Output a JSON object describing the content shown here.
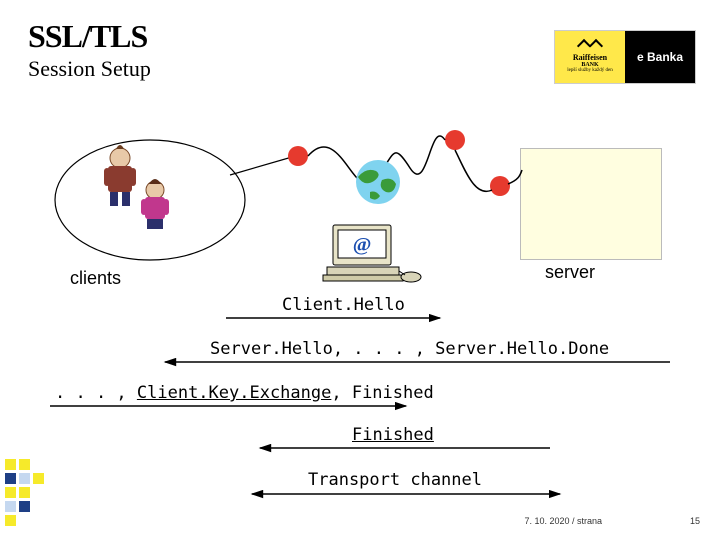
{
  "title": "SSL/TLS",
  "subtitle": "Session Setup",
  "logo": {
    "bank": "Raiffeisen",
    "sub": "BANK",
    "tag": "lepší služby každý den",
    "ebank": "e Banka"
  },
  "labels": {
    "clients": "clients",
    "server": "server"
  },
  "messages": {
    "m1": "Client.Hello",
    "m2": "Server.Hello, . . . , Server.Hello.Done",
    "m3_a": ". . . , ",
    "m3_b": "Client.Key.Exchange",
    "m3_c": ", Finished",
    "m4": "Finished",
    "m5": "Transport channel"
  },
  "footer": {
    "date": "7. 10. 2020 / strana",
    "page": "15"
  },
  "accent": {
    "yellow": "#f6ea2a",
    "darkblue": "#1e3f85",
    "lightblue": "#c5d8f0"
  }
}
